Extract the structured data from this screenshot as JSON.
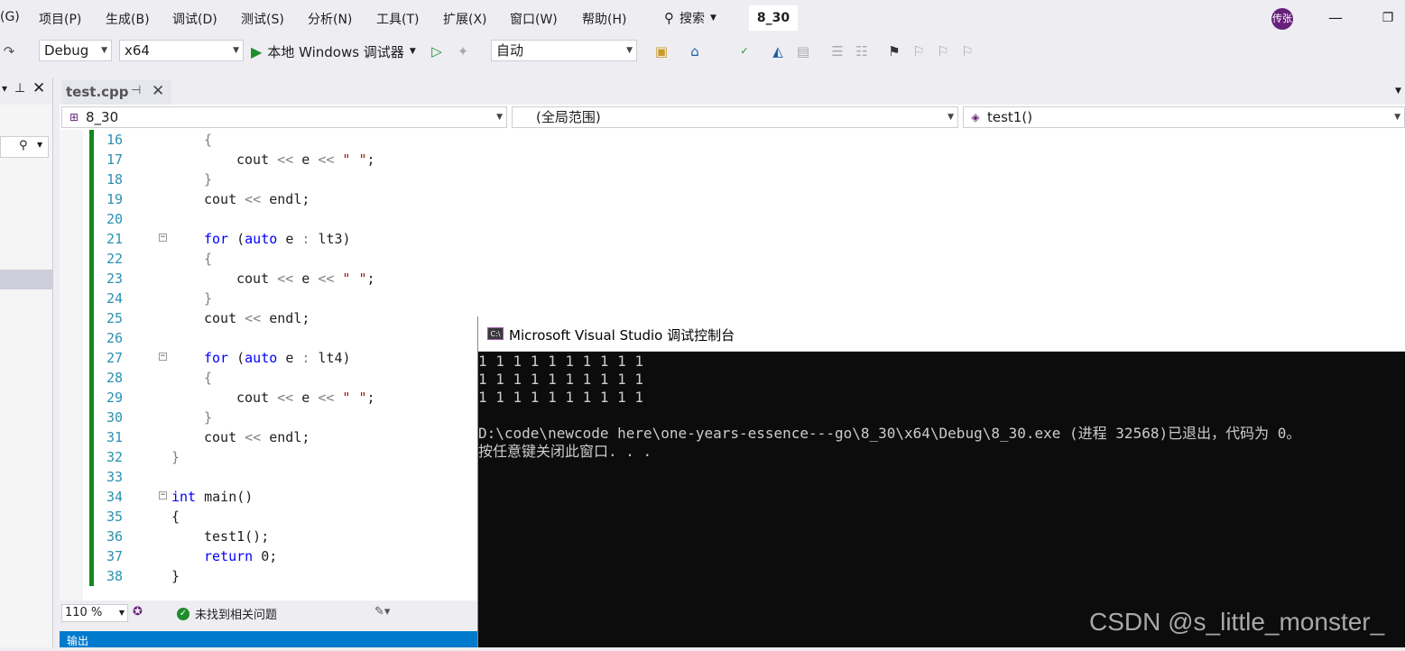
{
  "menu": {
    "items": [
      "(G)",
      "项目(P)",
      "生成(B)",
      "调试(D)",
      "测试(S)",
      "分析(N)",
      "工具(T)",
      "扩展(X)",
      "窗口(W)",
      "帮助(H)"
    ],
    "search_label": "搜索",
    "solution_name": "8_30",
    "avatar_text": "传张"
  },
  "toolbar": {
    "configuration": "Debug",
    "platform": "x64",
    "run_label": "本地 Windows 调试器",
    "auto_combo": "自动"
  },
  "editor": {
    "tab_label": "test.cpp",
    "nav": {
      "project": "8_30",
      "scope": "(全局范围)",
      "member": "test1()"
    },
    "zoom": "110 %",
    "issues_text": "未找到相关问题",
    "output_label": "输出",
    "lines": [
      {
        "n": "16",
        "indent": 1,
        "fold": false,
        "bar": true,
        "tokens": [
          [
            "op",
            "{"
          ]
        ]
      },
      {
        "n": "17",
        "indent": 2,
        "fold": false,
        "bar": true,
        "tokens": [
          [
            "id",
            "cout "
          ],
          [
            "op",
            "<< "
          ],
          [
            "id",
            "e "
          ],
          [
            "op",
            "<< "
          ],
          [
            "str",
            "\" \""
          ],
          [
            "id",
            ";"
          ]
        ]
      },
      {
        "n": "18",
        "indent": 1,
        "fold": false,
        "bar": true,
        "tokens": [
          [
            "op",
            "}"
          ]
        ]
      },
      {
        "n": "19",
        "indent": 1,
        "fold": false,
        "bar": true,
        "tokens": [
          [
            "id",
            "cout "
          ],
          [
            "op",
            "<< "
          ],
          [
            "id",
            "endl;"
          ]
        ]
      },
      {
        "n": "20",
        "indent": 1,
        "fold": false,
        "bar": true,
        "tokens": []
      },
      {
        "n": "21",
        "indent": 1,
        "fold": true,
        "bar": true,
        "tokens": [
          [
            "kw",
            "for "
          ],
          [
            "id",
            "("
          ],
          [
            "kw",
            "auto "
          ],
          [
            "id",
            "e "
          ],
          [
            "op",
            ": "
          ],
          [
            "id",
            "lt3)"
          ]
        ]
      },
      {
        "n": "22",
        "indent": 1,
        "fold": false,
        "bar": true,
        "tokens": [
          [
            "op",
            "{"
          ]
        ]
      },
      {
        "n": "23",
        "indent": 2,
        "fold": false,
        "bar": true,
        "tokens": [
          [
            "id",
            "cout "
          ],
          [
            "op",
            "<< "
          ],
          [
            "id",
            "e "
          ],
          [
            "op",
            "<< "
          ],
          [
            "str",
            "\" \""
          ],
          [
            "id",
            ";"
          ]
        ]
      },
      {
        "n": "24",
        "indent": 1,
        "fold": false,
        "bar": true,
        "tokens": [
          [
            "op",
            "}"
          ]
        ]
      },
      {
        "n": "25",
        "indent": 1,
        "fold": false,
        "bar": true,
        "tokens": [
          [
            "id",
            "cout "
          ],
          [
            "op",
            "<< "
          ],
          [
            "id",
            "endl;"
          ]
        ]
      },
      {
        "n": "26",
        "indent": 1,
        "fold": false,
        "bar": true,
        "tokens": []
      },
      {
        "n": "27",
        "indent": 1,
        "fold": true,
        "bar": true,
        "tokens": [
          [
            "kw",
            "for "
          ],
          [
            "id",
            "("
          ],
          [
            "kw",
            "auto "
          ],
          [
            "id",
            "e "
          ],
          [
            "op",
            ": "
          ],
          [
            "id",
            "lt4)"
          ]
        ]
      },
      {
        "n": "28",
        "indent": 1,
        "fold": false,
        "bar": true,
        "tokens": [
          [
            "op",
            "{"
          ]
        ]
      },
      {
        "n": "29",
        "indent": 2,
        "fold": false,
        "bar": true,
        "tokens": [
          [
            "id",
            "cout "
          ],
          [
            "op",
            "<< "
          ],
          [
            "id",
            "e "
          ],
          [
            "op",
            "<< "
          ],
          [
            "str",
            "\" \""
          ],
          [
            "id",
            ";"
          ]
        ]
      },
      {
        "n": "30",
        "indent": 1,
        "fold": false,
        "bar": true,
        "tokens": [
          [
            "op",
            "}"
          ]
        ]
      },
      {
        "n": "31",
        "indent": 1,
        "fold": false,
        "bar": true,
        "tokens": [
          [
            "id",
            "cout "
          ],
          [
            "op",
            "<< "
          ],
          [
            "id",
            "endl;"
          ]
        ]
      },
      {
        "n": "32",
        "indent": 0,
        "fold": false,
        "bar": true,
        "tokens": [
          [
            "op",
            "}"
          ]
        ]
      },
      {
        "n": "33",
        "indent": 0,
        "fold": false,
        "bar": true,
        "tokens": []
      },
      {
        "n": "34",
        "indent": 0,
        "fold": true,
        "bar": true,
        "tokens": [
          [
            "kw",
            "int "
          ],
          [
            "id",
            "main()"
          ]
        ]
      },
      {
        "n": "35",
        "indent": 0,
        "fold": false,
        "bar": true,
        "tokens": [
          [
            "id",
            "{"
          ]
        ]
      },
      {
        "n": "36",
        "indent": 1,
        "fold": false,
        "bar": true,
        "tokens": [
          [
            "id",
            "test1();"
          ]
        ]
      },
      {
        "n": "37",
        "indent": 1,
        "fold": false,
        "bar": true,
        "tokens": [
          [
            "kw",
            "return "
          ],
          [
            "id",
            "0;"
          ]
        ]
      },
      {
        "n": "38",
        "indent": 0,
        "fold": false,
        "bar": true,
        "tokens": [
          [
            "id",
            "}"
          ]
        ]
      }
    ]
  },
  "console": {
    "title": "Microsoft Visual Studio 调试控制台",
    "lines": [
      "1 1 1 1 1 1 1 1 1 1",
      "1 1 1 1 1 1 1 1 1 1",
      "1 1 1 1 1 1 1 1 1 1",
      "",
      "D:\\code\\newcode here\\one-years-essence---go\\8_30\\x64\\Debug\\8_30.exe (进程 32568)已退出，代码为 0。",
      "按任意键关闭此窗口. . ."
    ]
  },
  "watermark": "CSDN @s_little_monster_",
  "colors": {
    "keyword": "#0000ff",
    "string": "#a31515",
    "line_number": "#2b91af",
    "change_bar": "#108a1f",
    "console_bg": "#0c0c0c"
  }
}
